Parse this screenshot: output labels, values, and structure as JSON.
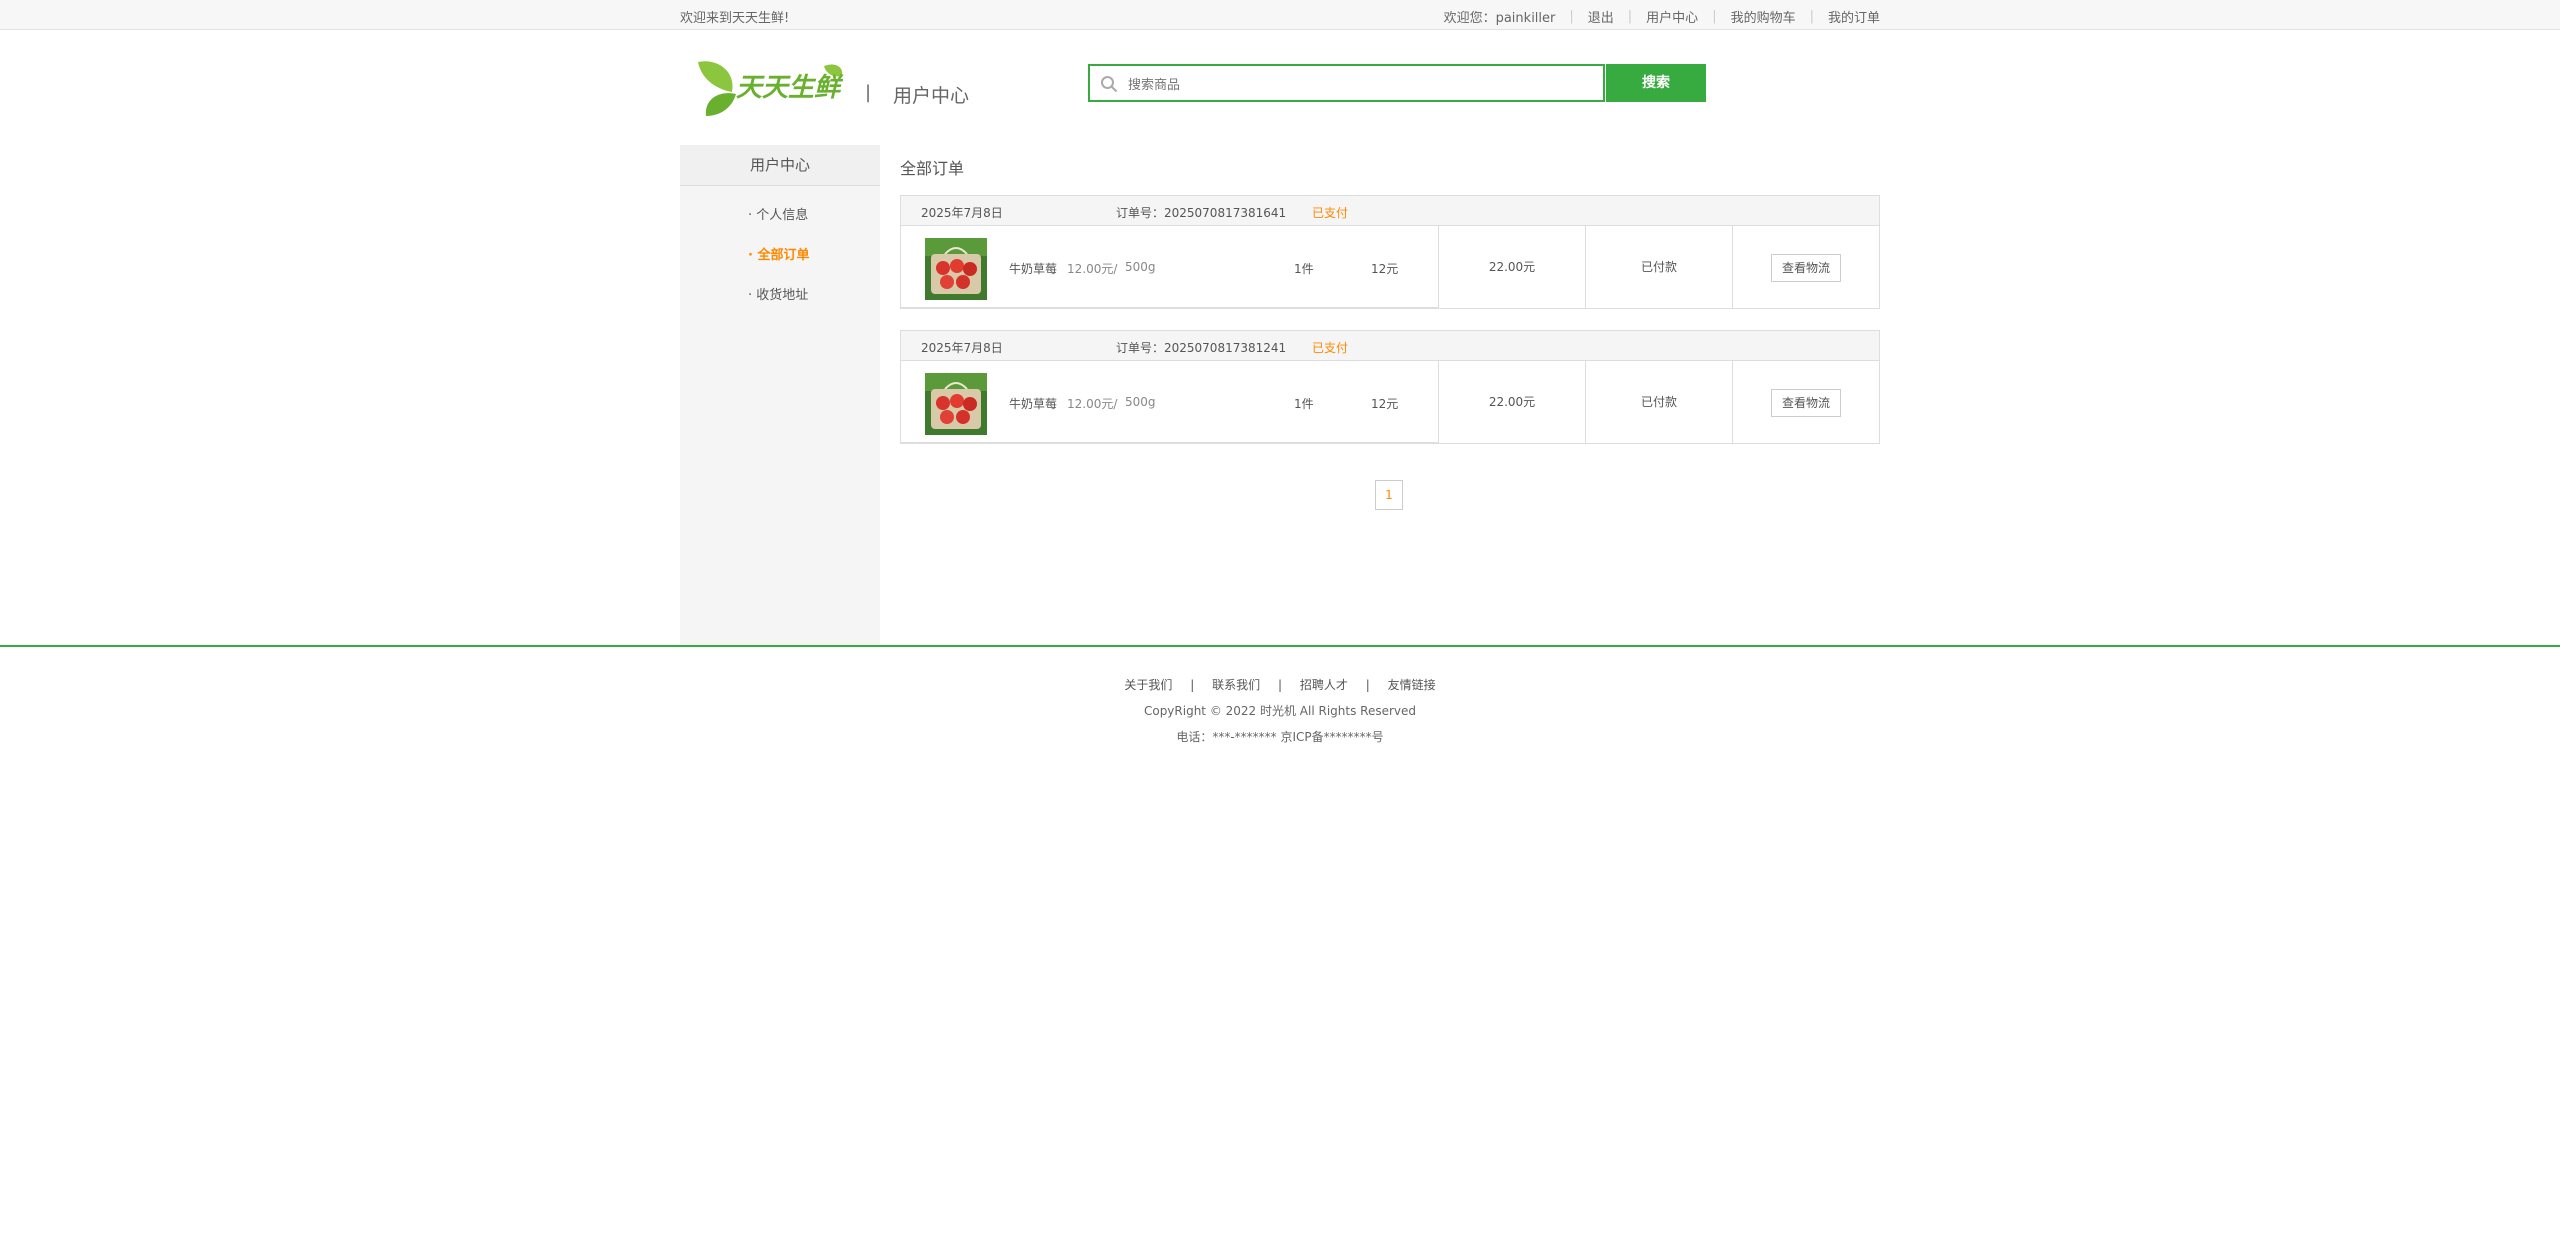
{
  "topbar": {
    "welcome": "欢迎来到天天生鲜!",
    "greeting": "欢迎您：painkiller",
    "logout": "退出",
    "user_center": "用户中心",
    "cart": "我的购物车",
    "orders": "我的订单"
  },
  "header": {
    "logo_text": "天天生鲜",
    "separator": "|",
    "title": "用户中心"
  },
  "search": {
    "placeholder": "搜索商品",
    "button": "搜索"
  },
  "sidebar": {
    "title": "用户中心",
    "items": [
      {
        "label": "· 个人信息"
      },
      {
        "label": "· 全部订单"
      },
      {
        "label": "· 收货地址"
      }
    ]
  },
  "main": {
    "title": "全部订单",
    "orders": [
      {
        "date": "2025年7月8日",
        "order_no": "订单号：2025070817381641",
        "status": "已支付",
        "goods_name": "牛奶草莓",
        "price": "12.00元/",
        "unit": "500g",
        "count": "1件",
        "subtotal": "12元",
        "total": "22.00元",
        "pay_state": "已付款",
        "action": "查看物流"
      },
      {
        "date": "2025年7月8日",
        "order_no": "订单号：2025070817381241",
        "status": "已支付",
        "goods_name": "牛奶草莓",
        "price": "12.00元/",
        "unit": "500g",
        "count": "1件",
        "subtotal": "12元",
        "total": "22.00元",
        "pay_state": "已付款",
        "action": "查看物流"
      }
    ],
    "page": "1"
  },
  "footer": {
    "links": [
      "关于我们",
      "联系我们",
      "招聘人才",
      "友情链接"
    ],
    "sep": "|",
    "copyright": "CopyRight © 2022 时光机 All Rights Reserved",
    "contact": "电话：***-******* 京ICP备********号"
  },
  "colors": {
    "accent_green": "#37ab40",
    "accent_orange": "#ff8800"
  }
}
